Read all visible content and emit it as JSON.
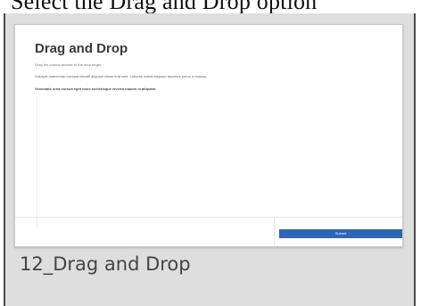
{
  "top_banner": {
    "text": "Select the Drag and Drop option"
  },
  "thumbnail": {
    "title": "Drag and Drop",
    "subtitle": "Drag the correct answer to the drop target.",
    "body": "Volutpat maecenas volutpat blandit aliquam etiam erat velit. Lobortis mattis aliquam faucibus purus in massa.",
    "question": "Venenatis urna cursus eget nunc scelerisque viverra mauris in aliquam.",
    "submit_label": "Submit"
  },
  "card": {
    "label": "12_Drag and Drop"
  },
  "colors": {
    "accent": "#2f66b3",
    "card_background": "#dedede",
    "label_text": "#444444"
  }
}
